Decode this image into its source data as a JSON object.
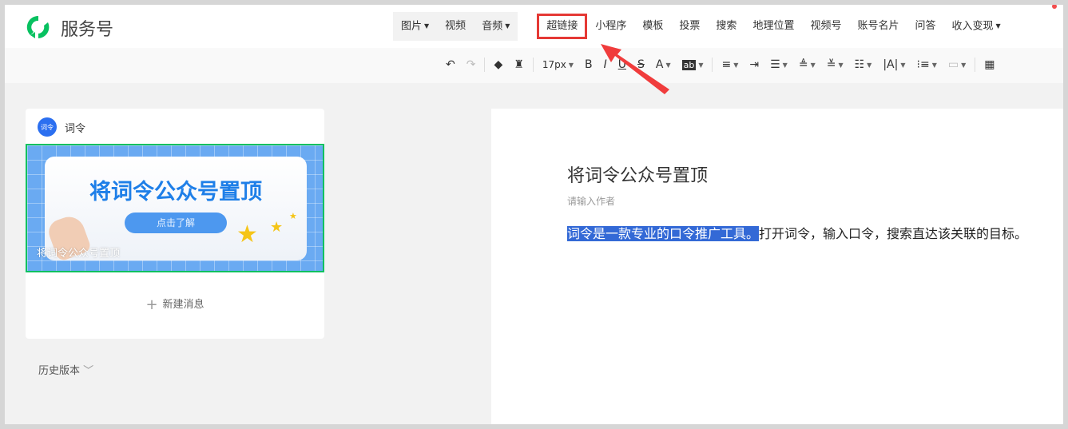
{
  "header": {
    "brand": "服务号",
    "nav_group": [
      {
        "label": "图片",
        "dropdown": true
      },
      {
        "label": "视频",
        "dropdown": false
      },
      {
        "label": "音频",
        "dropdown": true
      }
    ],
    "nav": [
      {
        "label": "超链接",
        "highlighted": true
      },
      {
        "label": "小程序"
      },
      {
        "label": "模板"
      },
      {
        "label": "投票"
      },
      {
        "label": "搜索"
      },
      {
        "label": "地理位置"
      },
      {
        "label": "视频号"
      },
      {
        "label": "账号名片"
      },
      {
        "label": "问答"
      },
      {
        "label": "收入变现",
        "dropdown": true
      }
    ],
    "highlight_color": "#e53935",
    "brand_color": "#07c160"
  },
  "toolbar": {
    "font_size": "17px",
    "bold": "B",
    "italic": "I",
    "underline": "U",
    "strike": "S",
    "font_color": "A",
    "bg_color": "ab"
  },
  "sidebar": {
    "account_avatar": "词令",
    "account_name": "词令",
    "cover_title": "将词令公众号置顶",
    "cover_button": "点击了解",
    "cover_caption": "将词令公众号置顶",
    "new_message": "新建消息",
    "history": "历史版本"
  },
  "editor": {
    "title": "将词令公众号置顶",
    "author_placeholder": "请输入作者",
    "selected_text": "词令是一款专业的口令推广工具。",
    "body_rest": "打开词令，输入口令，搜索直达该关联的目标。",
    "selection_color": "#3369d6"
  }
}
